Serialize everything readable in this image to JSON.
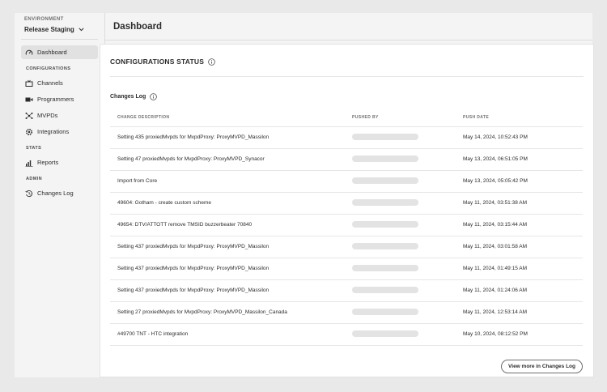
{
  "sidebar": {
    "env_label": "ENVIRONMENT",
    "env_value": "Release Staging",
    "items": {
      "dashboard": "Dashboard",
      "channels": "Channels",
      "programmers": "Programmers",
      "mvpds": "MVPDs",
      "integrations": "Integrations",
      "reports": "Reports",
      "changes_log": "Changes Log"
    },
    "sections": {
      "configurations": "CONFIGURATIONS",
      "stats": "STATS",
      "admin": "ADMIN"
    }
  },
  "header": {
    "title": "Dashboard"
  },
  "panel": {
    "title": "CONFIGURATIONS STATUS",
    "log_title": "Changes Log",
    "columns": [
      "CHANGE DESCRIPTION",
      "PUSHED BY",
      "PUSH DATE"
    ],
    "rows": [
      {
        "desc": "Setting 435 proxiedMvpds for MvpdProxy: ProxyMVPD_Massilon",
        "date": "May 14, 2024, 10:52:43 PM"
      },
      {
        "desc": "Setting 47 proxiedMvpds for MvpdProxy: ProxyMVPD_Synacor",
        "date": "May 13, 2024, 06:51:05 PM"
      },
      {
        "desc": "Import from Core",
        "date": "May 13, 2024, 05:05:42 PM"
      },
      {
        "desc": "49604: Gotham - create custom scheme",
        "date": "May 11, 2024, 03:51:38 AM"
      },
      {
        "desc": "49654: DTV/ATTOTT remove TMSID buzzerbeater 70840",
        "date": "May 11, 2024, 03:15:44 AM"
      },
      {
        "desc": "Setting 437 proxiedMvpds for MvpdProxy: ProxyMVPD_Massilon",
        "date": "May 11, 2024, 03:01:58 AM"
      },
      {
        "desc": "Setting 437 proxiedMvpds for MvpdProxy: ProxyMVPD_Massilon",
        "date": "May 11, 2024, 01:49:15 AM"
      },
      {
        "desc": "Setting 437 proxiedMvpds for MvpdProxy: ProxyMVPD_Massilon",
        "date": "May 11, 2024, 01:24:06 AM"
      },
      {
        "desc": "Setting 27 proxiedMvpds for MvpdProxy: ProxyMVPD_Massilon_Canada",
        "date": "May 11, 2024, 12:53:14 AM"
      },
      {
        "desc": "#49700 TNT - HTC integration",
        "date": "May 10, 2024, 08:12:52 PM"
      }
    ],
    "view_more_label": "View more in Changes Log"
  },
  "icons": {
    "dashboard": "gauge-icon",
    "channels": "tv-icon",
    "programmers": "video-camera-icon",
    "mvpds": "network-icon",
    "integrations": "gear-icon",
    "reports": "bar-chart-icon",
    "changes_log": "history-icon",
    "info": "info-icon",
    "chevron": "chevron-down-icon"
  },
  "colors": {
    "skeleton": "#e3e3e3",
    "active_nav": "#e1e1e1"
  }
}
